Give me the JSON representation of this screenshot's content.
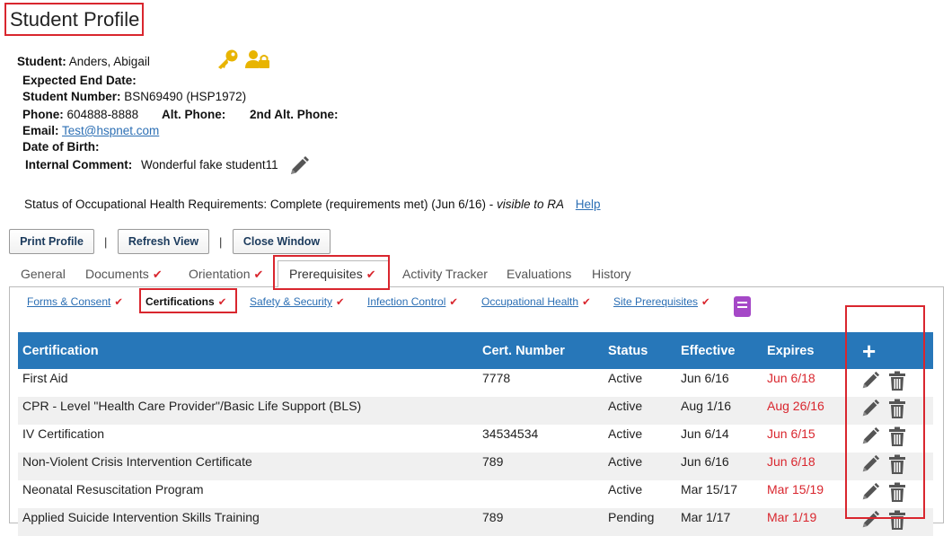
{
  "page": {
    "title": "Student Profile"
  },
  "student": {
    "label": "Student:",
    "name": "Anders, Abigail",
    "expected_end_date_label": "Expected End Date:",
    "student_number_label": "Student Number:",
    "student_number": "BSN69490  (HSP1972)",
    "phone_label": "Phone:",
    "phone": "604888-8888",
    "alt_phone_label": "Alt. Phone:",
    "second_alt_phone_label": "2nd Alt. Phone:",
    "email_label": "Email:",
    "email": "Test@hspnet.com",
    "dob_label": "Date of Birth:",
    "comment_label": "Internal Comment:",
    "comment": "Wonderful fake student11"
  },
  "status": {
    "text": "Status of Occupational Health Requirements: Complete (requirements met) (Jun 6/16) - ",
    "visible": "visible to RA",
    "help": "Help"
  },
  "buttons": {
    "print": "Print Profile",
    "refresh": "Refresh View",
    "close": "Close Window",
    "separator": "|"
  },
  "tabs": [
    "General",
    "Documents",
    "Orientation",
    "Prerequisites",
    "Activity Tracker",
    "Evaluations",
    "History"
  ],
  "check": "✔",
  "subtabs": [
    "Forms & Consent",
    "Certifications",
    "Safety & Security",
    "Infection Control",
    "Occupational Health",
    "Site Prerequisites"
  ],
  "table": {
    "headers": [
      "Certification",
      "Cert. Number",
      "Status",
      "Effective",
      "Expires"
    ],
    "add_symbol": "+",
    "rows": [
      {
        "name": "First Aid",
        "number": "7778",
        "status": "Active",
        "effective": "Jun 6/16",
        "expires": "Jun 6/18"
      },
      {
        "name": "CPR - Level \"Health Care Provider\"/Basic Life Support (BLS)",
        "number": "",
        "status": "Active",
        "effective": "Aug 1/16",
        "expires": "Aug 26/16"
      },
      {
        "name": "IV Certification",
        "number": "34534534",
        "status": "Active",
        "effective": "Jun 6/14",
        "expires": "Jun 6/15"
      },
      {
        "name": "Non-Violent Crisis Intervention Certificate",
        "number": "789",
        "status": "Active",
        "effective": "Jun 6/16",
        "expires": "Jun 6/18"
      },
      {
        "name": "Neonatal Resuscitation Program",
        "number": "",
        "status": "Active",
        "effective": "Mar 15/17",
        "expires": "Mar 15/19"
      },
      {
        "name": "Applied Suicide Intervention Skills Training",
        "number": "789",
        "status": "Pending",
        "effective": "Mar 1/17",
        "expires": "Mar 1/19"
      }
    ]
  },
  "colors": {
    "accent": "#2777b9",
    "highlight": "#d9262e",
    "link": "#2c6fb4",
    "icon_gold": "#e8b400",
    "book": "#a548c7"
  },
  "icons": {
    "key": "key-icon",
    "user_lock": "user-lock-icon",
    "edit": "pencil-icon",
    "delete": "trash-icon",
    "add": "plus-icon",
    "book": "book-icon"
  }
}
